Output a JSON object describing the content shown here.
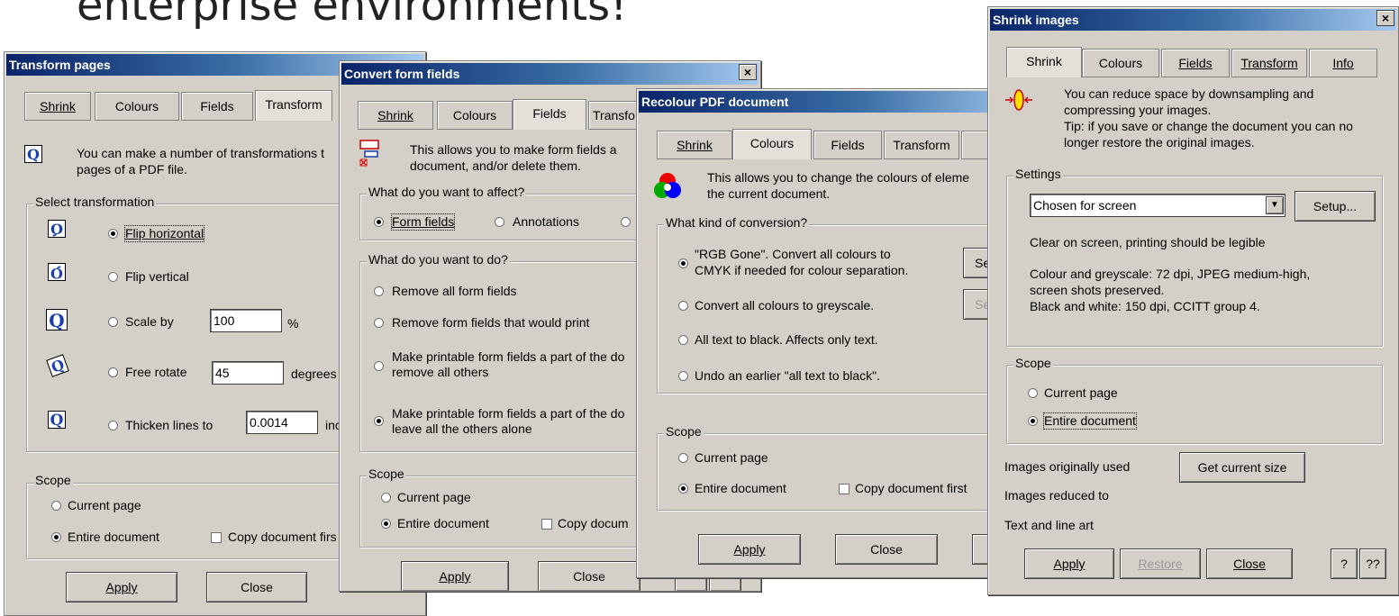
{
  "headline": "enterprise environments!",
  "transform": {
    "title": "Transform pages",
    "tabs": [
      "Shrink",
      "Colours",
      "Fields",
      "Transform"
    ],
    "intro": [
      "You can make a number of transformations t",
      "pages of a PDF file."
    ],
    "group_label": "Select transformation",
    "options": {
      "flip_h": "Flip horizontal",
      "flip_v": "Flip vertical",
      "scale": "Scale by",
      "scale_value": "100",
      "scale_unit": "%",
      "rotate": "Free rotate",
      "rotate_value": "45",
      "rotate_unit": "degrees",
      "thicken": "Thicken lines to",
      "thicken_value": "0.0014",
      "thicken_unit": "inc"
    },
    "scope_label": "Scope",
    "scope_current": "Current page",
    "scope_entire": "Entire document",
    "copy_first": "Copy document firs",
    "apply": "Apply",
    "close": "Close"
  },
  "fields": {
    "title": "Convert form fields",
    "tabs": [
      "Shrink",
      "Colours",
      "Fields",
      "Transfo"
    ],
    "intro": [
      "This allows you to make form fields a",
      "document, and/or delete them."
    ],
    "affect_label": "What do you want to affect?",
    "affect_form": "Form fields",
    "affect_annot": "Annotations",
    "do_label": "What do you want to do?",
    "do_remove_all": "Remove all form fields",
    "do_remove_print": "Remove form fields that would print",
    "do_make_remove": [
      "Make printable form fields a part of the do",
      "remove all others"
    ],
    "do_make_leave": [
      "Make printable form fields a part of the do",
      "leave all the others alone"
    ],
    "scope_label": "Scope",
    "scope_current": "Current page",
    "scope_entire": "Entire document",
    "copy_first": "Copy docum",
    "apply": "Apply",
    "close": "Close"
  },
  "recolour": {
    "title": "Recolour PDF document",
    "tabs": [
      "Shrink",
      "Colours",
      "Fields",
      "Transform"
    ],
    "intro": [
      "This allows you to change the colours of eleme",
      "the current document."
    ],
    "kind_label": "What kind of conversion?",
    "opt_rgb": [
      "\"RGB Gone\". Convert all colours to",
      "CMYK if needed for colour separation."
    ],
    "opt_grey": "Convert all colours to greyscale.",
    "opt_black": "All text to black. Affects only text.",
    "opt_undo": "Undo an earlier \"all text to black\".",
    "side_btn_1": "Se",
    "side_btn_2": "Se",
    "scope_label": "Scope",
    "scope_current": "Current page",
    "scope_entire": "Entire document",
    "copy_first": "Copy document first",
    "apply": "Apply",
    "close": "Close"
  },
  "shrink": {
    "title": "Shrink images",
    "tabs": [
      "Shrink",
      "Colours",
      "Fields",
      "Transform",
      "Info"
    ],
    "intro": [
      "You can reduce space by downsampling and",
      "compressing your images.",
      "Tip: if you save or change the document you can no",
      "longer restore the original images."
    ],
    "settings_label": "Settings",
    "preset": "Chosen for screen",
    "setup": "Setup...",
    "desc_1": "Clear on screen, printing should be legible",
    "desc_2": [
      "Colour and greyscale: 72 dpi, JPEG medium-high,",
      "screen shots preserved.",
      "Black and white: 150 dpi, CCITT group 4."
    ],
    "scope_label": "Scope",
    "scope_current": "Current page",
    "scope_entire": "Entire document",
    "images_used": "Images originally used",
    "get_size": "Get current size",
    "images_reduced": "Images reduced to",
    "text_line_art": "Text and line art",
    "apply": "Apply",
    "restore": "Restore",
    "close": "Close",
    "help": "?",
    "help2": "??"
  }
}
